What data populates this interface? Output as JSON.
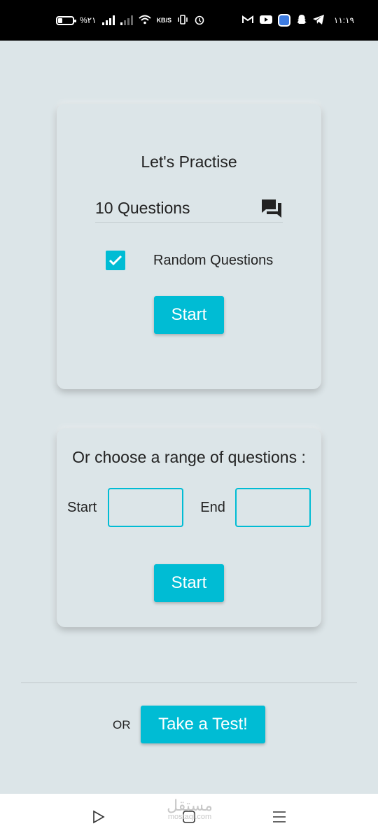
{
  "status_bar": {
    "battery": "%۲۱",
    "speed_unit": "KB/S",
    "time": "۱۱:۱۹"
  },
  "practise_card": {
    "title": "Let's Practise",
    "questions_value": "10 Questions",
    "random_label": "Random Questions",
    "random_checked": true,
    "start_label": "Start"
  },
  "range_card": {
    "title": "Or choose a range of questions :",
    "start_label": "Start",
    "start_value": "",
    "end_label": "End",
    "end_value": "",
    "button_label": "Start"
  },
  "footer": {
    "or_label": "OR",
    "test_button": "Take a Test!"
  },
  "watermark": {
    "arabic": "مستقل",
    "latin": "mostaql.com"
  },
  "colors": {
    "accent": "#00bcd4",
    "background": "#dce5e8"
  }
}
